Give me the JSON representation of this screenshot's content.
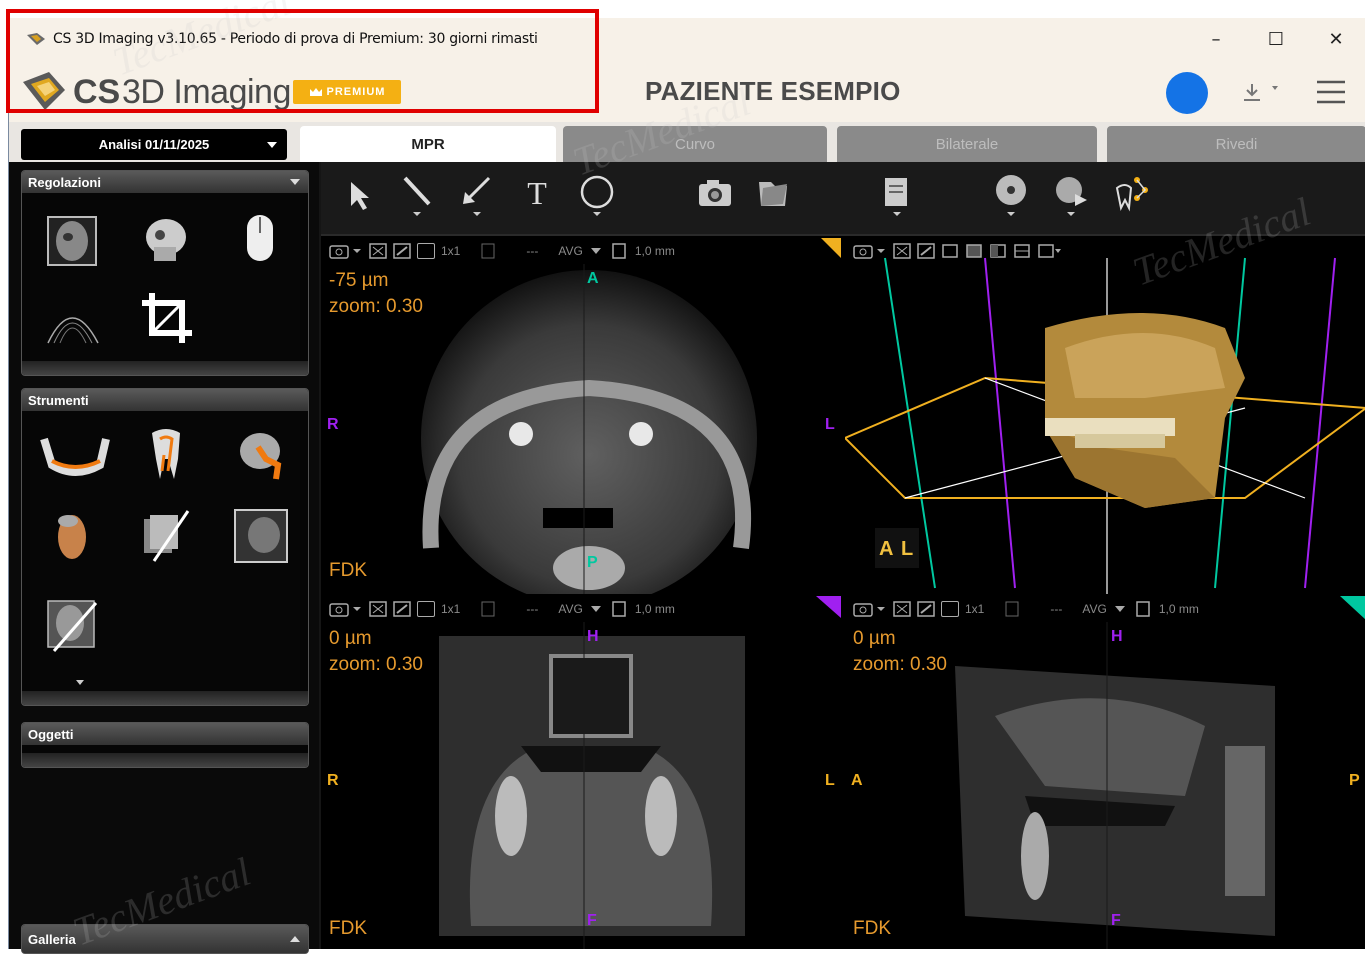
{
  "window": {
    "title": "CS 3D Imaging v3.10.65 - Periodo di prova di Premium: 30 giorni rimasti",
    "minimize": "–",
    "maximize": "☐",
    "close": "✕"
  },
  "header": {
    "logo_cs": "CS",
    "logo_rest": "3D Imaging",
    "premium_badge": "PREMIUM",
    "patient_name": "PAZIENTE ESEMPIO"
  },
  "tabs": {
    "analysis_select": "Analisi 01/11/2025",
    "items": [
      {
        "label": "MPR",
        "active": true
      },
      {
        "label": "Curvo",
        "active": false
      },
      {
        "label": "Bilaterale",
        "active": false
      },
      {
        "label": "Rivedi",
        "active": false
      }
    ]
  },
  "left_panel": {
    "regolazioni": "Regolazioni",
    "strumenti": "Strumenti",
    "oggetti": "Oggetti",
    "galleria": "Galleria"
  },
  "views": {
    "axial": {
      "layout": "1x1",
      "sep": "---",
      "mode": "AVG",
      "thickness": "1,0 mm",
      "offset": "-75 µm",
      "zoom": "zoom: 0.30",
      "label": "FDK",
      "marker_top": "A",
      "marker_bottom": "P",
      "marker_left": "R",
      "marker_right": "L"
    },
    "coronal": {
      "layout": "1x1",
      "sep": "---",
      "mode": "AVG",
      "thickness": "1,0 mm",
      "offset": "0 µm",
      "zoom": "zoom: 0.30",
      "label": "FDK",
      "marker_top": "H",
      "marker_bottom": "F",
      "marker_left": "R",
      "marker_right": "L"
    },
    "sagittal": {
      "layout": "1x1",
      "sep": "---",
      "mode": "AVG",
      "thickness": "1,0 mm",
      "offset": "0 µm",
      "zoom": "zoom: 0.30",
      "label": "FDK",
      "marker_top": "H",
      "marker_bottom": "F",
      "marker_left": "A",
      "marker_right": "P"
    },
    "volume": {
      "orient_a": "A",
      "orient_l": "L"
    }
  },
  "watermark": "TecMedical",
  "colors": {
    "accent_orange": "#e69a2e",
    "premium": "#f4b013",
    "avatar_blue": "#1473e6",
    "highlight_red": "#e00000",
    "axis_green": "#00c8a0",
    "axis_purple": "#a020f0",
    "axis_yellow": "#f0b020"
  }
}
